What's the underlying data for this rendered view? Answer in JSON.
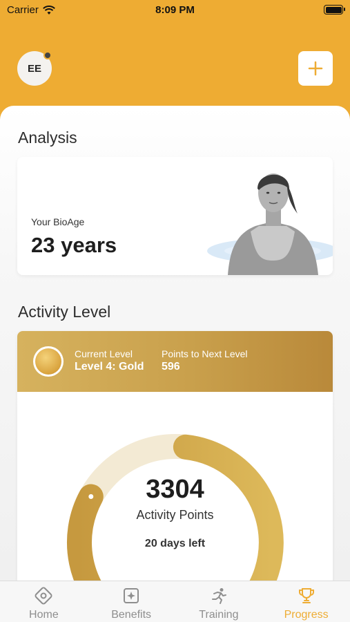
{
  "status_bar": {
    "carrier": "Carrier",
    "time": "8:09 PM"
  },
  "header": {
    "avatar_initials": "EE",
    "add_icon": "plus-icon"
  },
  "analysis": {
    "title": "Analysis",
    "bioage_label": "Your BioAge",
    "bioage_value": "23 years"
  },
  "activity": {
    "title": "Activity Level",
    "current_level_label": "Current Level",
    "current_level_value": "Level 4: Gold",
    "next_level_label": "Points to Next Level",
    "next_level_value": "596",
    "points": "3304",
    "points_label": "Activity Points",
    "days_left": "20 days left"
  },
  "tabs": [
    {
      "label": "Home",
      "icon": "home-icon",
      "active": false
    },
    {
      "label": "Benefits",
      "icon": "benefits-icon",
      "active": false
    },
    {
      "label": "Training",
      "icon": "running-icon",
      "active": false
    },
    {
      "label": "Progress",
      "icon": "trophy-icon",
      "active": true
    }
  ],
  "colors": {
    "accent": "#eeac33",
    "gold_dark": "#b9893a",
    "gold_light": "#d6b25e"
  }
}
